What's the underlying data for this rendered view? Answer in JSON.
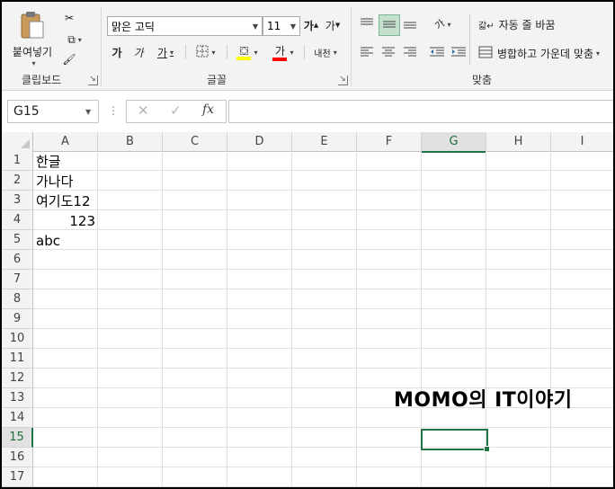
{
  "ribbon": {
    "clipboard": {
      "paste_label": "붙여넣기",
      "group_label": "클립보드"
    },
    "font": {
      "font_name": "맑은 고딕",
      "font_size": "11",
      "grow_label": "가",
      "shrink_label": "가",
      "bold_label": "가",
      "italic_label": "가",
      "underline_label": "가",
      "font_color_label": "가",
      "phonetic_label": "내천",
      "group_label": "글꼴",
      "highlight_color": "#ffff00",
      "font_color": "#ff0000"
    },
    "alignment": {
      "orientation_label": "가",
      "wrap_text_label": "자동 줄 바꿈",
      "merge_center_label": "병합하고 가운데 맞춤",
      "group_label": "맞춤"
    }
  },
  "formula_bar": {
    "name_box": "G15",
    "fx_label": "fx",
    "formula": ""
  },
  "sheet": {
    "columns": [
      "A",
      "B",
      "C",
      "D",
      "E",
      "F",
      "G",
      "H",
      "I"
    ],
    "selected_column": "G",
    "rows": [
      "1",
      "2",
      "3",
      "4",
      "5",
      "6",
      "7",
      "8",
      "9",
      "10",
      "11",
      "12",
      "13",
      "14",
      "15",
      "16",
      "17"
    ],
    "selected_row": "15",
    "cells": {
      "A1": "한글",
      "A2": "가나다",
      "A3": "여기도12",
      "A4": "123",
      "A5": "abc"
    },
    "active_cell": "G15",
    "accent_color": "#217346"
  },
  "watermark": "MOMO의 IT이야기"
}
